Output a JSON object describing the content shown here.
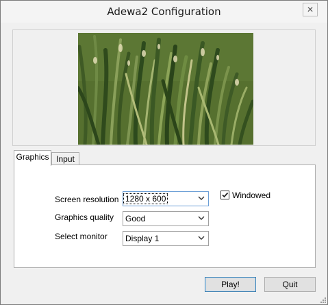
{
  "window": {
    "title": "Adewa2 Configuration",
    "close_glyph": "✕"
  },
  "tabs": [
    {
      "label": "Graphics",
      "active": true
    },
    {
      "label": "Input",
      "active": false
    }
  ],
  "graphics": {
    "screen_resolution": {
      "label": "Screen resolution",
      "value": "1280 x 600"
    },
    "graphics_quality": {
      "label": "Graphics quality",
      "value": "Good"
    },
    "select_monitor": {
      "label": "Select monitor",
      "value": "Display 1"
    },
    "windowed": {
      "label": "Windowed",
      "checked": true
    }
  },
  "buttons": {
    "play": "Play!",
    "quit": "Quit"
  },
  "colors": {
    "accent": "#3c7fb1",
    "grass": "#4e6a2a"
  }
}
